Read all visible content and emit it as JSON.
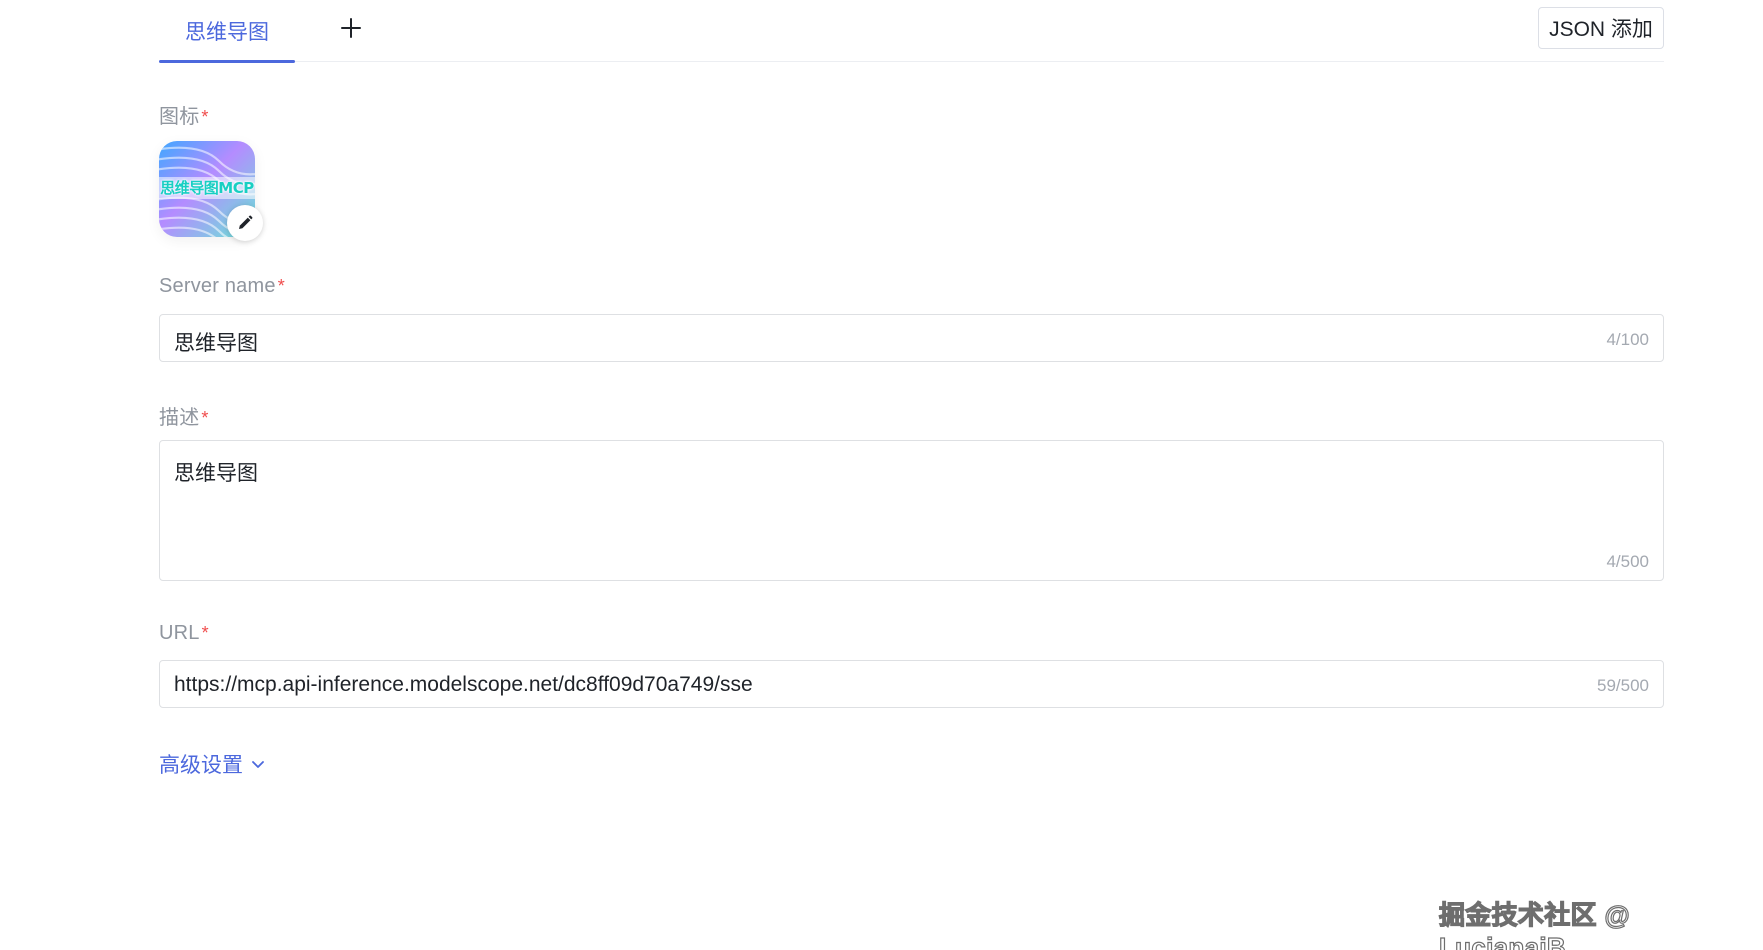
{
  "tabs": [
    {
      "label": "思维导图",
      "active": true
    }
  ],
  "toolbar": {
    "json_add_label": "JSON 添加"
  },
  "form": {
    "icon": {
      "label": "图标",
      "required_mark": "*",
      "image_text": "思维导图MCP",
      "edit_icon": "pencil-icon"
    },
    "server_name": {
      "label": "Server name",
      "required_mark": "*",
      "value": "思维导图",
      "counter": "4/100"
    },
    "description": {
      "label": "描述",
      "required_mark": "*",
      "value": "思维导图",
      "counter": "4/500"
    },
    "url": {
      "label": "URL",
      "required_mark": "*",
      "value": "https://mcp.api-inference.modelscope.net/dc8ff09d70a749/sse",
      "counter": "59/500"
    },
    "advanced": {
      "label": "高级设置",
      "icon": "chevron-down-icon"
    }
  },
  "watermark": "掘金技术社区 @ LucianaiB",
  "colors": {
    "accent": "#4c68dd",
    "required": "#f04c4c",
    "label": "#8f959e",
    "border": "#dee0e3"
  }
}
